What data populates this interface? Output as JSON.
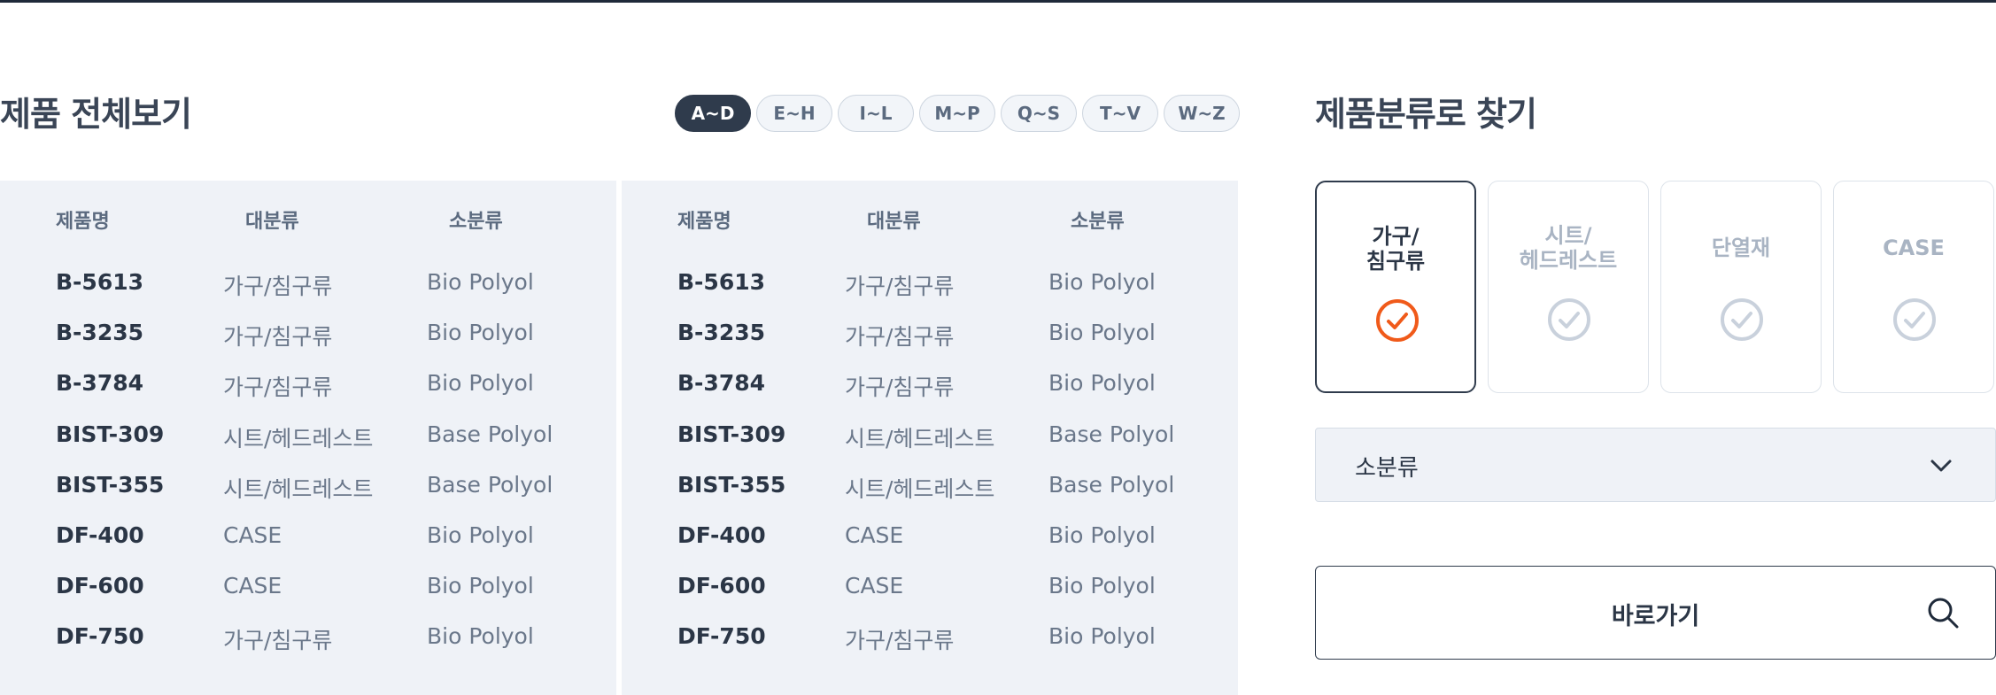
{
  "section_titles": {
    "all_products": "제품 전체보기",
    "by_category": "제품분류로 찾기"
  },
  "alpha_tabs": [
    "A~D",
    "E~H",
    "I~L",
    "M~P",
    "Q~S",
    "T~V",
    "W~Z"
  ],
  "active_tab": "A~D",
  "table": {
    "headers": [
      "제품명",
      "대분류",
      "소분류"
    ],
    "rows": [
      [
        "B-5613",
        "가구/침구류",
        "Bio Polyol"
      ],
      [
        "B-3235",
        "가구/침구류",
        "Bio Polyol"
      ],
      [
        "B-3784",
        "가구/침구류",
        "Bio Polyol"
      ],
      [
        "BIST-309",
        "시트/헤드레스트",
        "Base Polyol"
      ],
      [
        "BIST-355",
        "시트/헤드레스트",
        "Base Polyol"
      ],
      [
        "DF-400",
        "CASE",
        "Bio Polyol"
      ],
      [
        "DF-600",
        "CASE",
        "Bio Polyol"
      ],
      [
        "DF-750",
        "가구/침구류",
        "Bio Polyol"
      ]
    ]
  },
  "categories": [
    {
      "label": "가구/\n침구류",
      "selected": true
    },
    {
      "label": "시트/\n헤드레스트",
      "selected": false
    },
    {
      "label": "단열재",
      "selected": false
    },
    {
      "label": "CASE",
      "selected": false
    }
  ],
  "subcategory_select": {
    "value": "소분류",
    "icon": "chevron-down-icon"
  },
  "go_button": {
    "label": "바로가기",
    "icon": "search-icon"
  },
  "colors": {
    "accent": "#f05a1a",
    "dark": "#2f3b4c",
    "panel_bg": "#eff2f7",
    "inactive_check": "#c9d1dc"
  }
}
